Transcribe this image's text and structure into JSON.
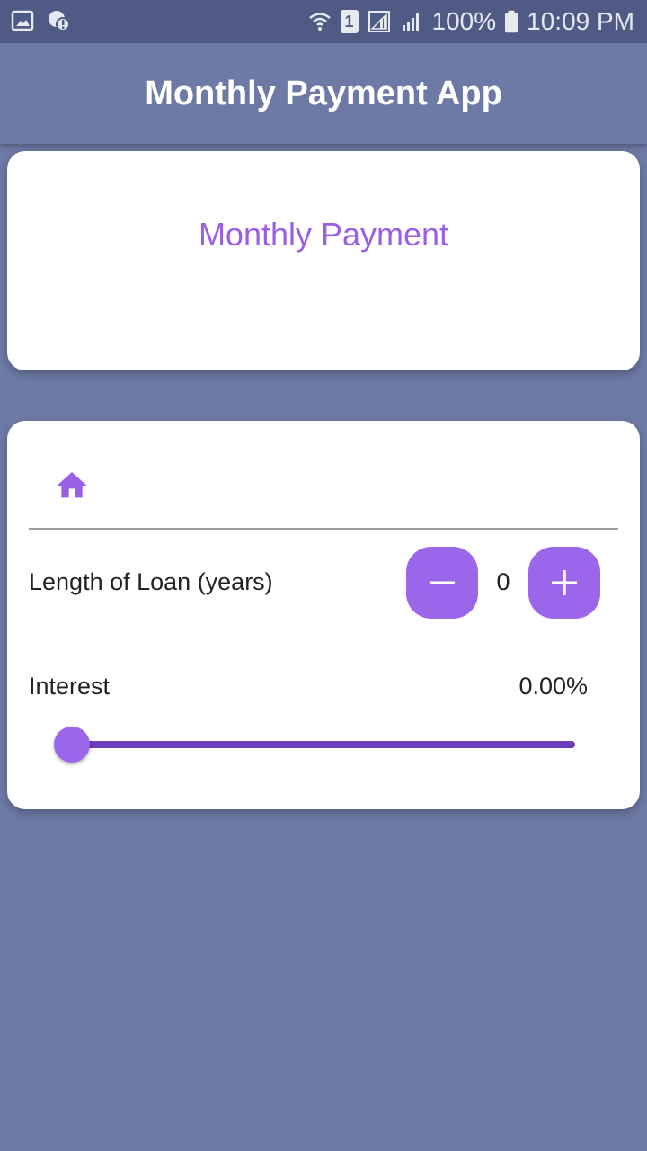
{
  "status_bar": {
    "left_icons": [
      "image-icon",
      "alert-icon"
    ],
    "right_icons": [
      "wifi-icon",
      "sim-icon",
      "signal-icon",
      "signal-icon",
      "battery-icon"
    ],
    "sim_number": "1",
    "battery": "100%",
    "time": "10:09 PM"
  },
  "app_bar": {
    "title": "Monthly Payment App"
  },
  "payment_card": {
    "title": "Monthly Payment"
  },
  "loan_card": {
    "icon": "home-icon",
    "loan_length": {
      "label": "Length of Loan (years)",
      "value": "0",
      "decrement_icon": "minus-icon",
      "increment_icon": "plus-icon"
    },
    "interest": {
      "label": "Interest",
      "value": "0.00%",
      "slider_fraction": 0.0
    }
  },
  "colors": {
    "background": "#6e7aa6",
    "status_bar": "#4f5b84",
    "accent": "#9b66ea",
    "accent_dark": "#6a3dbd",
    "card": "#ffffff"
  }
}
